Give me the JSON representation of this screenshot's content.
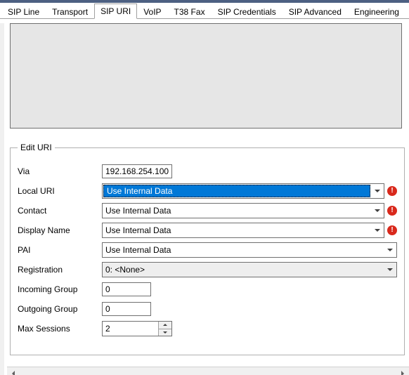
{
  "tabs": [
    {
      "label": "SIP Line"
    },
    {
      "label": "Transport"
    },
    {
      "label": "SIP URI"
    },
    {
      "label": "VoIP"
    },
    {
      "label": "T38 Fax"
    },
    {
      "label": "SIP Credentials"
    },
    {
      "label": "SIP Advanced"
    },
    {
      "label": "Engineering"
    }
  ],
  "active_tab": "SIP URI",
  "fieldset": {
    "legend": "Edit URI",
    "fields": {
      "via": {
        "label": "Via",
        "value": "192.168.254.100"
      },
      "local_uri": {
        "label": "Local URI",
        "value": "Use Internal Data",
        "error": true,
        "selected": true
      },
      "contact": {
        "label": "Contact",
        "value": "Use Internal Data",
        "error": true
      },
      "display_name": {
        "label": "Display Name",
        "value": "Use Internal Data",
        "error": true
      },
      "pai": {
        "label": "PAI",
        "value": "Use Internal Data"
      },
      "registration": {
        "label": "Registration",
        "value": "0: <None>"
      },
      "incoming_group": {
        "label": "Incoming Group",
        "value": "0"
      },
      "outgoing_group": {
        "label": "Outgoing Group",
        "value": "0"
      },
      "max_sessions": {
        "label": "Max Sessions",
        "value": "2"
      }
    }
  }
}
